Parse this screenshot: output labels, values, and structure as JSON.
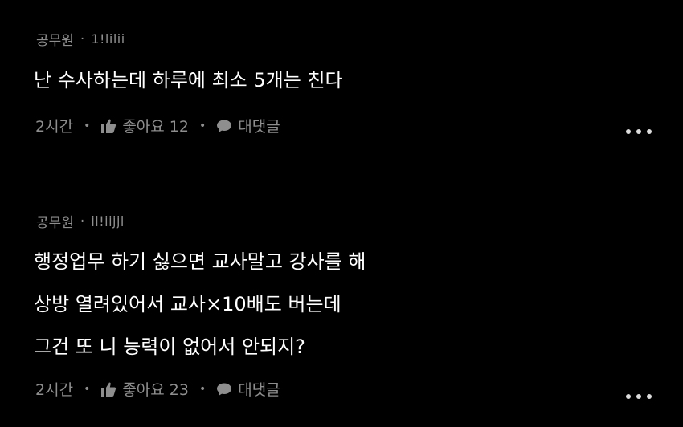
{
  "comments": [
    {
      "author": "공무원",
      "separator": "·",
      "handle": "1!lilii",
      "lines": [
        "난 수사하는데 하루에 최소 5개는 친다"
      ],
      "time": "2시간",
      "like_label": "좋아요 12",
      "reply_label": "대댓글"
    },
    {
      "author": "공무원",
      "separator": "·",
      "handle": "il!iijjl",
      "lines": [
        "행정업무 하기 싫으면 교사말고 강사를 해",
        "상방 열려있어서 교사×10배도 버는데",
        "그건 또 니 능력이 없어서 안되지?"
      ],
      "time": "2시간",
      "like_label": "좋아요 23",
      "reply_label": "대댓글"
    }
  ],
  "colors": {
    "background": "#000000",
    "text": "#ffffff",
    "muted": "#8e8e8e"
  },
  "icons": {
    "like": "thumbs-up-icon",
    "reply": "speech-bubble-icon",
    "more": "more-dots-icon"
  }
}
